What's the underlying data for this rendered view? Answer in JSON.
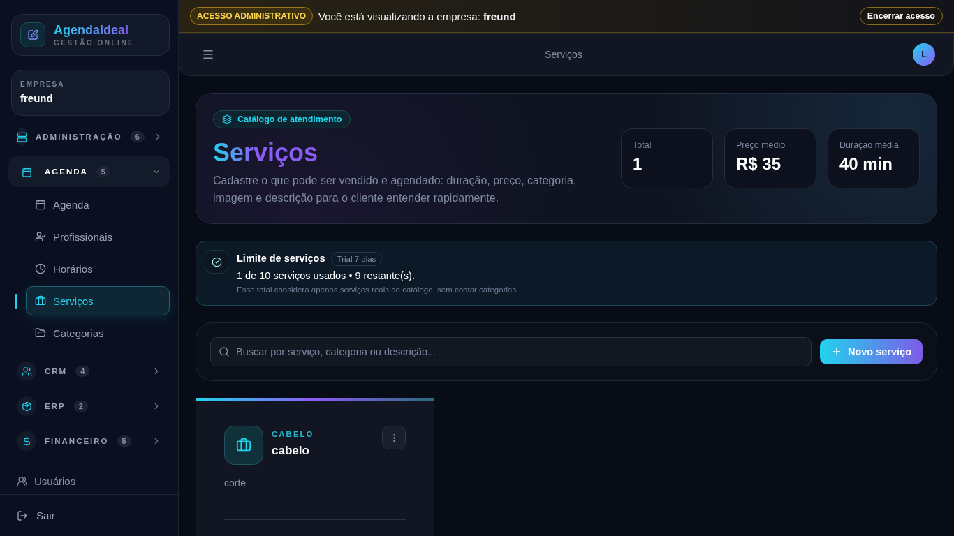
{
  "brand": {
    "name": "AgendaIdeal",
    "tagline": "GESTÃO ONLINE"
  },
  "company": {
    "label": "EMPRESA",
    "name": "freund"
  },
  "nav": [
    {
      "label": "ADMINISTRAÇÃO",
      "count": "6",
      "expanded": false
    },
    {
      "label": "AGENDA",
      "count": "5",
      "expanded": true,
      "children": [
        {
          "label": "Agenda",
          "selected": false
        },
        {
          "label": "Profissionais",
          "selected": false
        },
        {
          "label": "Horários",
          "selected": false
        },
        {
          "label": "Serviços",
          "selected": true
        },
        {
          "label": "Categorias",
          "selected": false
        }
      ]
    },
    {
      "label": "CRM",
      "count": "4",
      "expanded": false
    },
    {
      "label": "ERP",
      "count": "2",
      "expanded": false
    },
    {
      "label": "FINANCEIRO",
      "count": "5",
      "expanded": false
    }
  ],
  "extra_link": "Usuários",
  "logout": "Sair",
  "banner": {
    "badge": "ACESSO ADMINISTRATIVO",
    "message": "Você está visualizando a empresa: **freund**",
    "button": "Encerrar acesso"
  },
  "topbar": {
    "title": "Serviços",
    "avatar": "L"
  },
  "hero": {
    "chip": "Catálogo de atendimento",
    "title": "Serviços",
    "description": "Cadastre o que pode ser vendido e agendado: duração, preço, categoria, imagem e descrição para o cliente entender rapidamente.",
    "stats": [
      {
        "label": "Total",
        "value": "1"
      },
      {
        "label": "Preço médio",
        "value": "R$ 35"
      },
      {
        "label": "Duração média",
        "value": "40 min"
      }
    ]
  },
  "limit": {
    "title": "Limite de serviços",
    "badge": "Trial 7 dias",
    "usage": "1 de 10 serviços usados • 9 restante(s).",
    "note": "Esse total considera apenas serviços reais do catálogo, sem contar categorias."
  },
  "search": {
    "placeholder": "Buscar por serviço, categoria ou descrição...",
    "button": "Novo serviço"
  },
  "services": [
    {
      "category": "CABELO",
      "name": "cabelo",
      "description": "corte"
    }
  ]
}
